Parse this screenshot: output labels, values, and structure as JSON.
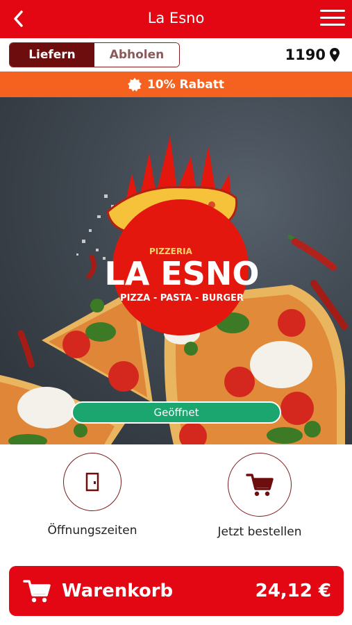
{
  "header": {
    "title": "La Esno"
  },
  "mode_toggle": {
    "deliver_label": "Liefern",
    "pickup_label": "Abholen",
    "active": "deliver"
  },
  "location": {
    "zip": "1190"
  },
  "discount": {
    "text": "10% Rabatt"
  },
  "hero": {
    "logo": {
      "line1": "PIZZERIA",
      "line2": "LA ESNO",
      "line3": "PIZZA - PASTA - BURGER"
    },
    "status": "Geöffnet"
  },
  "actions": [
    {
      "label": "Öffnungszeiten",
      "icon": "door-icon"
    },
    {
      "label": "Jetzt bestellen",
      "icon": "cart-icon"
    }
  ],
  "cart": {
    "label": "Warenkorb",
    "total": "24,12 €"
  },
  "colors": {
    "primary": "#e30613",
    "dark_red": "#6d0d0d",
    "discount": "#f5611e",
    "open_green": "#1aa66e"
  }
}
